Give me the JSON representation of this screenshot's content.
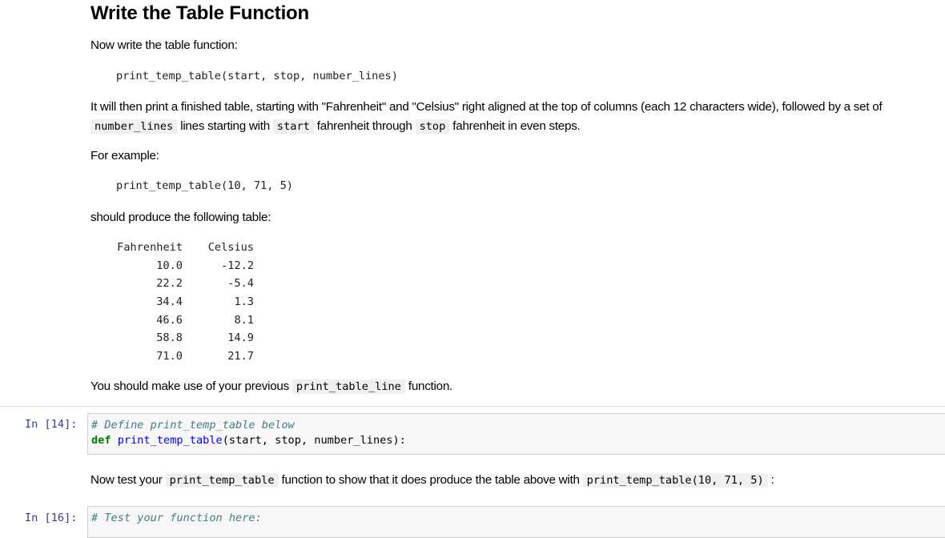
{
  "heading": "Write the Table Function",
  "intro": "Now write the table function:",
  "signature": "print_temp_table(start, stop, number_lines)",
  "desc": {
    "line1": "It will then print a finished table, starting with \"Fahrenheit\" and \"Celsius\" right aligned at the top of columns (each 12 characters wide), followed by a set of",
    "code_number_lines": "number_lines",
    "text_a": " lines starting with ",
    "code_start": "start",
    "text_b": " fahrenheit through ",
    "code_stop": "stop",
    "text_c": " fahrenheit in even steps."
  },
  "example_label": "For example:",
  "example_call": "print_temp_table(10, 71, 5)",
  "should_produce": "should produce the following table:",
  "table": {
    "headers": [
      "Fahrenheit",
      "Celsius"
    ],
    "rows": [
      [
        "10.0",
        "-12.2"
      ],
      [
        "22.2",
        "-5.4"
      ],
      [
        "34.4",
        "1.3"
      ],
      [
        "46.6",
        "8.1"
      ],
      [
        "58.8",
        "14.9"
      ],
      [
        "71.0",
        "21.7"
      ]
    ]
  },
  "use_previous": {
    "before": "You should make use of your previous ",
    "code": "print_table_line",
    "after": " function."
  },
  "cell1": {
    "prompt": "In [14]:",
    "comment": "# Define print_temp_table below",
    "keyword": "def",
    "func_name": "print_temp_table",
    "args": "(start, stop, number_lines):"
  },
  "test_text": {
    "before": "Now test your ",
    "code1": "print_temp_table",
    "middle": " function to show that it does produce the table above with ",
    "code2": "print_temp_table(10, 71, 5)",
    "after": " :"
  },
  "cell2": {
    "prompt": "In [16]:",
    "comment": "# Test your function here:"
  }
}
